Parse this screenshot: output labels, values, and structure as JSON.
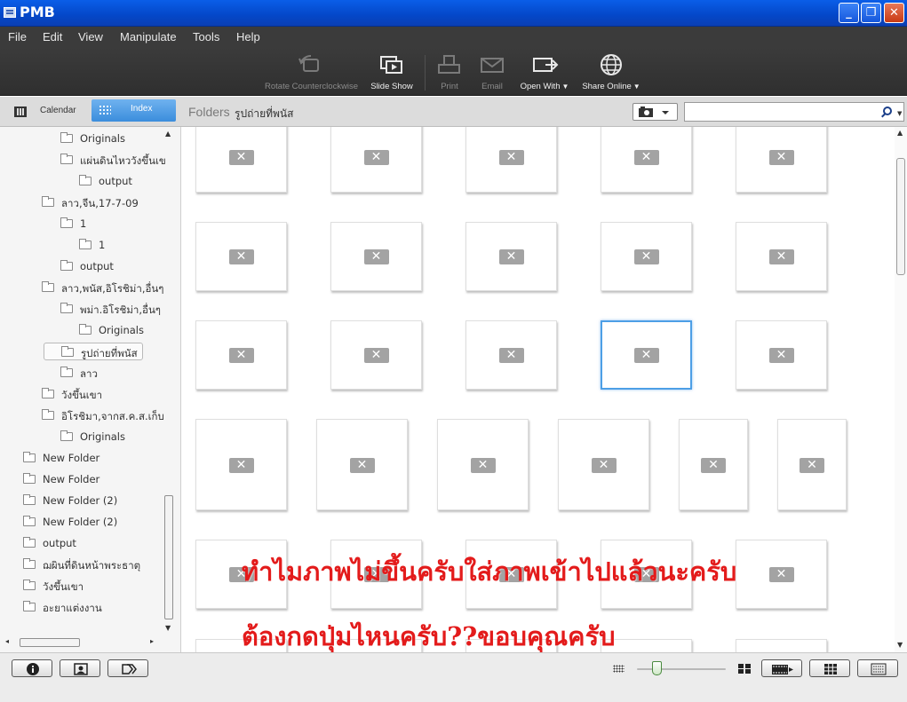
{
  "window": {
    "title": "PMB",
    "controls": {
      "minimize": "_",
      "restore": "❐",
      "close": "✕"
    }
  },
  "menu": [
    "File",
    "Edit",
    "View",
    "Manipulate",
    "Tools",
    "Help"
  ],
  "toolbar": [
    {
      "label": "Rotate Counterclockwise",
      "icon": "rotate-ccw-icon",
      "enabled": false
    },
    {
      "label": "Slide Show",
      "icon": "slideshow-icon",
      "enabled": true
    },
    {
      "label": "Print",
      "icon": "print-icon",
      "enabled": false
    },
    {
      "label": "Email",
      "icon": "email-icon",
      "enabled": false
    },
    {
      "label": "Open With",
      "icon": "open-with-icon",
      "enabled": true,
      "dropdown": true
    },
    {
      "label": "Share Online",
      "icon": "globe-icon",
      "enabled": true,
      "dropdown": true
    }
  ],
  "nav": {
    "calendar_label": "Calendar",
    "index_label": "Index",
    "active_view": "Index",
    "breadcrumb_root": "Folders",
    "breadcrumb_current": "รูปถ่ายที่พนัส",
    "search_value": ""
  },
  "folders": [
    {
      "label": "Originals",
      "depth": 2
    },
    {
      "label": "แผ่นดินไหววังขึ้นเข",
      "depth": 2
    },
    {
      "label": "output",
      "depth": 3
    },
    {
      "label": "ลาว,จีน,17-7-09",
      "depth": 1
    },
    {
      "label": "1",
      "depth": 2
    },
    {
      "label": "1",
      "depth": 3
    },
    {
      "label": "output",
      "depth": 2
    },
    {
      "label": "ลาว,พนัส,อิโรชิม่า,อื่นๆ",
      "depth": 1
    },
    {
      "label": "พม่า.อิโรชิม่า,อื่นๆ",
      "depth": 2
    },
    {
      "label": "Originals",
      "depth": 3
    },
    {
      "label": "รูปถ่ายที่พนัส",
      "depth": 2,
      "selected": true
    },
    {
      "label": "ลาว",
      "depth": 2
    },
    {
      "label": "วังขึ้นเขา",
      "depth": 1
    },
    {
      "label": "อิโรชิมา,จากส.ค.ส.เก็บ",
      "depth": 1
    },
    {
      "label": "Originals",
      "depth": 2
    },
    {
      "label": "New Folder",
      "depth": 0
    },
    {
      "label": "New Folder",
      "depth": 0
    },
    {
      "label": "New Folder (2)",
      "depth": 0
    },
    {
      "label": "New Folder (2)",
      "depth": 0
    },
    {
      "label": "output",
      "depth": 0
    },
    {
      "label": "ฌผินที่ดินหน้าพระธาตุ",
      "depth": 0
    },
    {
      "label": "วังขึ้นเขา",
      "depth": 0
    },
    {
      "label": "อะยาแต่งงาน",
      "depth": 0
    }
  ],
  "grid": {
    "row_columns": [
      5,
      5,
      5,
      6,
      5,
      5
    ],
    "selected": {
      "row": 2,
      "col": 3
    },
    "broken_icon": "broken-image-icon"
  },
  "overlay": {
    "line1": "ทำไมภาพไม่ขึ้นครับใส่ภาพเข้าไปแล้วนะครับ",
    "line2": "ต้องกดปุ่มไหนครับ??ขอบคุณครับ",
    "color": "#e31b1b"
  },
  "status": {
    "buttons": [
      "info-icon",
      "people-icon",
      "tags-icon"
    ],
    "zoom_level": 0.22,
    "view_modes": [
      "filmstrip-icon",
      "grid-view-icon",
      "details-view-icon"
    ],
    "active_view_mode": "grid-view-icon"
  },
  "colors": {
    "accent": "#4d9fe6",
    "title_bar": "#0a5ee8",
    "toolbar": "#333333"
  }
}
